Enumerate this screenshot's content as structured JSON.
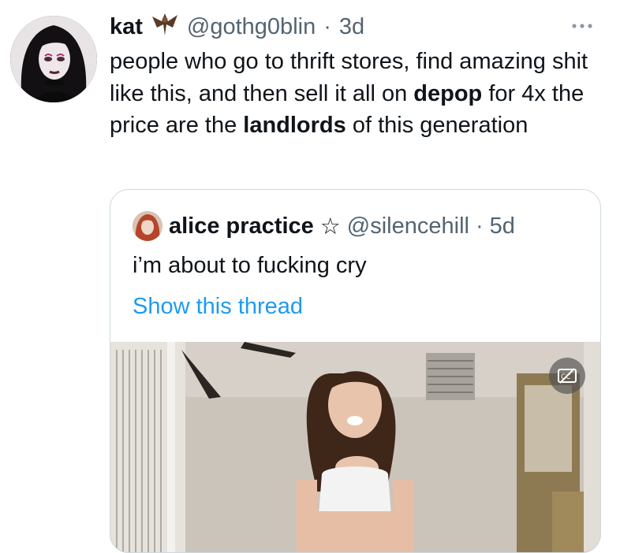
{
  "tweet": {
    "author_name": "kat",
    "author_emoji": "bat-emoji",
    "handle": "@gothg0blin",
    "separator": "·",
    "time": "3d",
    "text_parts": [
      "people who go to thrift stores, find amazing shit like this, and then sell it all on ",
      "depop",
      " for 4x the price are the ",
      "landlords",
      " of this generation"
    ]
  },
  "quoted": {
    "author_name": "alice practice",
    "author_symbol": "☆",
    "handle": "@silencehill",
    "separator": "·",
    "time": "5d",
    "text": "i’m about to fucking cry",
    "thread_link": "Show this thread"
  },
  "icons": {
    "more": "more-icon",
    "captions": "captions-off-icon"
  },
  "colors": {
    "link": "#1d9bf0",
    "secondary_text": "#536471",
    "border": "#cfd9de"
  }
}
